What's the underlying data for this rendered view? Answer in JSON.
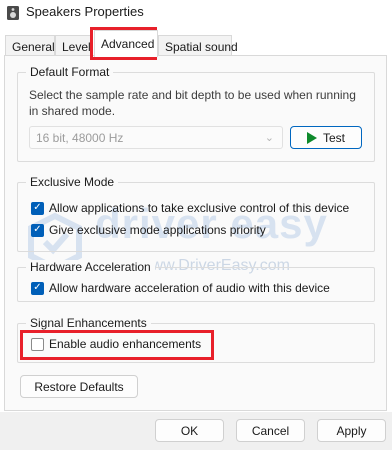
{
  "window": {
    "title": "Speakers Properties"
  },
  "tabs": [
    {
      "label": "General"
    },
    {
      "label": "Levels"
    },
    {
      "label": "Advanced"
    },
    {
      "label": "Spatial sound"
    }
  ],
  "default_format": {
    "group_label": "Default Format",
    "description": "Select the sample rate and bit depth to be used when running in shared mode.",
    "selected": "16 bit, 48000 Hz",
    "test_label": "Test"
  },
  "exclusive_mode": {
    "group_label": "Exclusive Mode",
    "allow_label": "Allow applications to take exclusive control of this device",
    "allow_checked": true,
    "priority_label": "Give exclusive mode applications priority",
    "priority_checked": true
  },
  "hardware_acceleration": {
    "group_label": "Hardware Acceleration",
    "allow_label": "Allow hardware acceleration of audio with this device",
    "allow_checked": true
  },
  "signal_enhancements": {
    "group_label": "Signal Enhancements",
    "enable_label": "Enable audio enhancements",
    "enable_checked": false
  },
  "buttons": {
    "restore": "Restore Defaults",
    "ok": "OK",
    "cancel": "Cancel",
    "apply": "Apply"
  },
  "watermark": {
    "brand": "driver easy",
    "url": "www.DriverEasy.com"
  },
  "colors": {
    "highlight": "#e8202a",
    "checkbox_checked": "#005fb8",
    "test_play": "#0e8a2c"
  }
}
